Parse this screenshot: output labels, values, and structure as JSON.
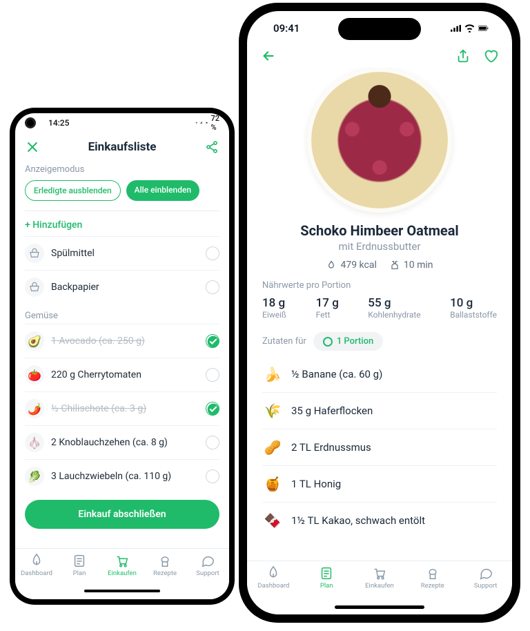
{
  "left": {
    "status": {
      "time": "14:25",
      "battery": "72 %"
    },
    "header": {
      "title": "Einkaufsliste"
    },
    "anzeigemodus_label": "Anzeigemodus",
    "chip_hide": "Erledigte ausblenden",
    "chip_show": "Alle einblenden",
    "add_label": "+ Hinzufügen",
    "custom_items": [
      {
        "label": "Spülmittel"
      },
      {
        "label": "Backpapier"
      }
    ],
    "category": "Gemüse",
    "veg_items": [
      {
        "label": "1 Avocado (ca. 250 g)",
        "done": true,
        "emoji": "🥑"
      },
      {
        "label": "220 g Cherrytomaten",
        "done": false,
        "emoji": "🍅"
      },
      {
        "label": "½ Chilischote (ca. 3 g)",
        "done": true,
        "emoji": "🌶️"
      },
      {
        "label": "2 Knoblauchzehen (ca. 8 g)",
        "done": false,
        "emoji": "🧄"
      },
      {
        "label": "3 Lauchzwiebeln (ca. 110 g)",
        "done": false,
        "emoji": "🥬"
      }
    ],
    "finish_btn": "Einkauf abschließen"
  },
  "right": {
    "status": {
      "time": "09:41"
    },
    "recipe": {
      "title": "Schoko Himbeer Oatmeal",
      "subtitle": "mit Erdnussbutter",
      "kcal": "479 kcal",
      "time": "10 min"
    },
    "nutrition_label": "Nährwerte pro Portion",
    "nutrition": [
      {
        "value": "18 g",
        "label": "Eiweiß"
      },
      {
        "value": "17 g",
        "label": "Fett"
      },
      {
        "value": "55 g",
        "label": "Kohlenhydrate"
      },
      {
        "value": "10 g",
        "label": "Ballaststoffe"
      }
    ],
    "ingredients_label": "Zutaten für",
    "portion": "1 Portion",
    "ingredients": [
      {
        "label": "½ Banane (ca. 60 g)",
        "emoji": "🍌"
      },
      {
        "label": "35 g Haferflocken",
        "emoji": "🌾"
      },
      {
        "label": "2 TL Erdnussmus",
        "emoji": "🥜"
      },
      {
        "label": "1 TL Honig",
        "emoji": "🍯"
      },
      {
        "label": "1½ TL Kakao, schwach entölt",
        "emoji": "🍫"
      }
    ]
  },
  "tabs": [
    {
      "key": "dashboard",
      "label": "Dashboard"
    },
    {
      "key": "plan",
      "label": "Plan"
    },
    {
      "key": "einkaufen",
      "label": "Einkaufen"
    },
    {
      "key": "rezepte",
      "label": "Rezepte"
    },
    {
      "key": "support",
      "label": "Support"
    }
  ],
  "active_tab_left": "einkaufen",
  "active_tab_right": "plan"
}
